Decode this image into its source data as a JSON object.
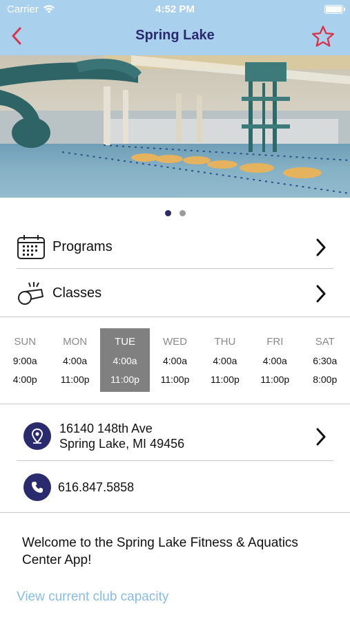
{
  "status_bar": {
    "carrier": "Carrier",
    "time": "4:52 PM"
  },
  "nav": {
    "title": "Spring Lake",
    "back_icon": "chevron-left-icon",
    "favorite_icon": "star-outline-icon"
  },
  "colors": {
    "nav_bg": "#a9d0ec",
    "title": "#2a2a6e",
    "accent_red": "#d9344a",
    "link": "#87bde3",
    "today_bg": "#808080"
  },
  "carousel": {
    "page_count": 2,
    "active_index": 0
  },
  "menu": [
    {
      "label": "Programs",
      "icon": "calendar-icon"
    },
    {
      "label": "Classes",
      "icon": "whistle-icon"
    }
  ],
  "hours": [
    {
      "day": "SUN",
      "open": "9:00a",
      "close": "4:00p",
      "today": false
    },
    {
      "day": "MON",
      "open": "4:00a",
      "close": "11:00p",
      "today": false
    },
    {
      "day": "TUE",
      "open": "4:00a",
      "close": "11:00p",
      "today": true
    },
    {
      "day": "WED",
      "open": "4:00a",
      "close": "11:00p",
      "today": false
    },
    {
      "day": "THU",
      "open": "4:00a",
      "close": "11:00p",
      "today": false
    },
    {
      "day": "FRI",
      "open": "4:00a",
      "close": "11:00p",
      "today": false
    },
    {
      "day": "SAT",
      "open": "6:30a",
      "close": "8:00p",
      "today": false
    }
  ],
  "contact": {
    "address_line1": "16140 148th Ave",
    "address_line2": "Spring Lake, MI 49456",
    "phone": "616.847.5858"
  },
  "welcome": "Welcome to the Spring Lake Fitness & Aquatics Center App!",
  "capacity_link": "View current club capacity"
}
